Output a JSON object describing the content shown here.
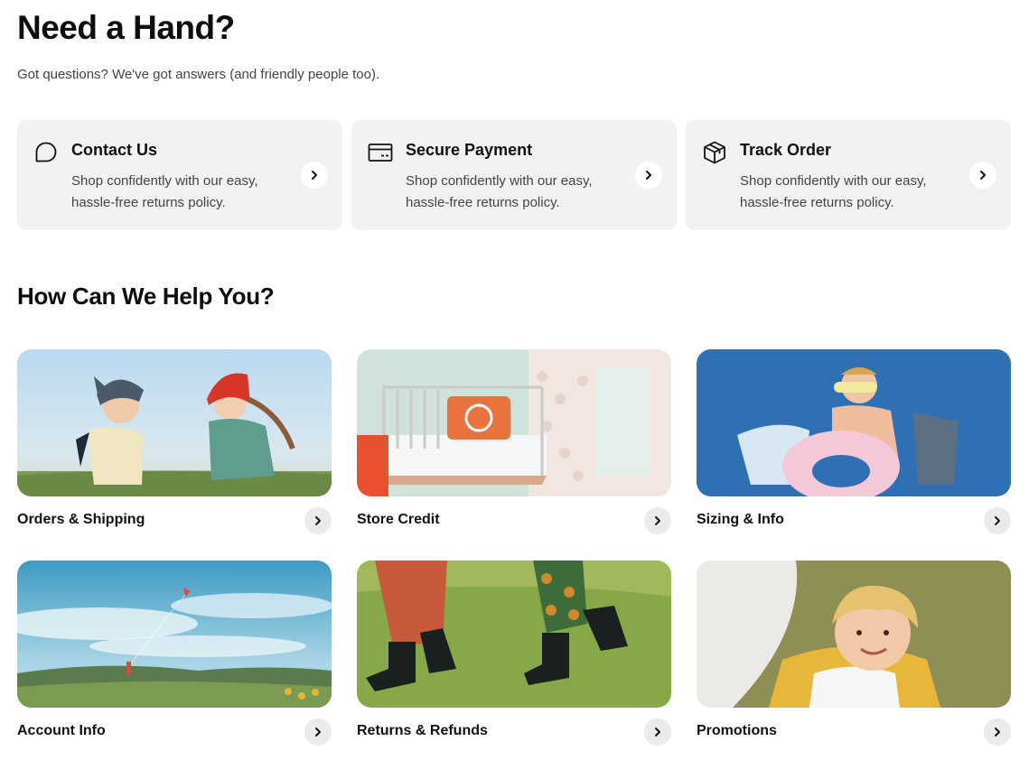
{
  "header": {
    "title": "Need a Hand?",
    "subtitle": "Got questions? We've got answers (and friendly people too)."
  },
  "support_cards": [
    {
      "title": "Contact Us",
      "description": "Shop confidently with our easy, hassle-free returns policy.",
      "icon": "chat-bubble-icon"
    },
    {
      "title": "Secure Payment",
      "description": "Shop confidently with our easy, hassle-free returns policy.",
      "icon": "credit-card-icon"
    },
    {
      "title": "Track Order",
      "description": "Shop confidently with our easy, hassle-free returns policy.",
      "icon": "package-box-icon"
    }
  ],
  "help_section": {
    "title": "How Can We Help You?",
    "topics": [
      {
        "label": "Orders & Shipping",
        "image": "kids-running-in-field"
      },
      {
        "label": "Store Credit",
        "image": "kids-bedroom-bed"
      },
      {
        "label": "Sizing & Info",
        "image": "boy-with-swim-ring"
      },
      {
        "label": "Account Info",
        "image": "child-flying-kite"
      },
      {
        "label": "Returns & Refunds",
        "image": "kids-legs-in-rain-boots"
      },
      {
        "label": "Promotions",
        "image": "smiling-toddler"
      }
    ]
  }
}
